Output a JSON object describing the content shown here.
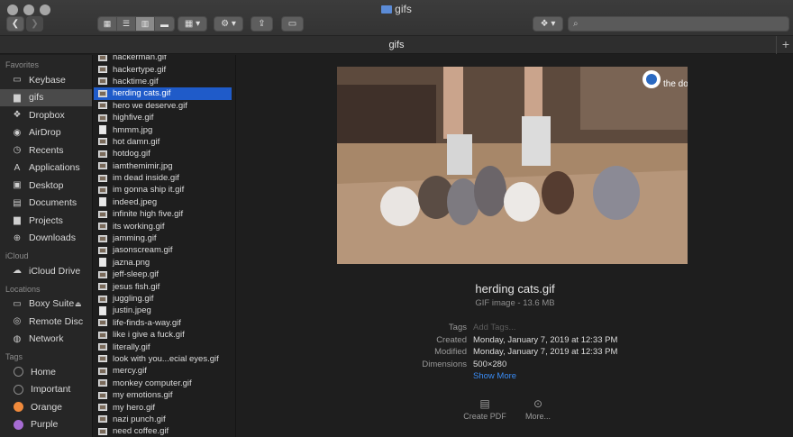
{
  "window": {
    "title": "gifs",
    "path_title": "gifs"
  },
  "toolbar": {
    "search_placeholder": ""
  },
  "sidebar": {
    "sections": [
      {
        "heading": "Favorites",
        "items": [
          {
            "label": "Keybase",
            "icon": "drive-icon"
          },
          {
            "label": "gifs",
            "icon": "folder-icon",
            "selected": true
          },
          {
            "label": "Dropbox",
            "icon": "dropbox-icon"
          },
          {
            "label": "AirDrop",
            "icon": "airdrop-icon"
          },
          {
            "label": "Recents",
            "icon": "clock-icon"
          },
          {
            "label": "Applications",
            "icon": "applications-icon"
          },
          {
            "label": "Desktop",
            "icon": "desktop-icon"
          },
          {
            "label": "Documents",
            "icon": "document-icon"
          },
          {
            "label": "Projects",
            "icon": "folder-icon"
          },
          {
            "label": "Downloads",
            "icon": "downloads-icon"
          }
        ]
      },
      {
        "heading": "iCloud",
        "items": [
          {
            "label": "iCloud Drive",
            "icon": "cloud-icon"
          }
        ]
      },
      {
        "heading": "Locations",
        "items": [
          {
            "label": "Boxy Suite",
            "icon": "drive-icon",
            "eject": "⏏"
          },
          {
            "label": "Remote Disc",
            "icon": "disc-icon"
          },
          {
            "label": "Network",
            "icon": "globe-icon"
          }
        ]
      },
      {
        "heading": "Tags",
        "items": [
          {
            "label": "Home",
            "tag_color": "none"
          },
          {
            "label": "Important",
            "tag_color": "none"
          },
          {
            "label": "Orange",
            "tag_color": "#f08a3c"
          },
          {
            "label": "Purple",
            "tag_color": "#a66cd3"
          }
        ]
      }
    ]
  },
  "files": [
    {
      "name": "hackerman.gif",
      "type": "image"
    },
    {
      "name": "hackertype.gif",
      "type": "image"
    },
    {
      "name": "hacktime.gif",
      "type": "image"
    },
    {
      "name": "herding cats.gif",
      "type": "image",
      "selected": true
    },
    {
      "name": "hero we deserve.gif",
      "type": "image"
    },
    {
      "name": "highfive.gif",
      "type": "image"
    },
    {
      "name": "hmmm.jpg",
      "type": "doc"
    },
    {
      "name": "hot damn.gif",
      "type": "image"
    },
    {
      "name": "hotdog.gif",
      "type": "image"
    },
    {
      "name": "iamthemimir.jpg",
      "type": "image"
    },
    {
      "name": "im dead inside.gif",
      "type": "image"
    },
    {
      "name": "im gonna ship it.gif",
      "type": "image"
    },
    {
      "name": "indeed.jpeg",
      "type": "doc"
    },
    {
      "name": "infinite high five.gif",
      "type": "image"
    },
    {
      "name": "its working.gif",
      "type": "image"
    },
    {
      "name": "jamming.gif",
      "type": "image"
    },
    {
      "name": "jasonscream.gif",
      "type": "image"
    },
    {
      "name": "jazna.png",
      "type": "doc"
    },
    {
      "name": "jeff-sleep.gif",
      "type": "image"
    },
    {
      "name": "jesus fish.gif",
      "type": "image"
    },
    {
      "name": "juggling.gif",
      "type": "image"
    },
    {
      "name": "justin.jpeg",
      "type": "doc"
    },
    {
      "name": "life-finds-a-way.gif",
      "type": "image"
    },
    {
      "name": "like i give a fuck.gif",
      "type": "image"
    },
    {
      "name": "literally.gif",
      "type": "image"
    },
    {
      "name": "look with you...ecial eyes.gif",
      "type": "image"
    },
    {
      "name": "mercy.gif",
      "type": "image"
    },
    {
      "name": "monkey computer.gif",
      "type": "image"
    },
    {
      "name": "my emotions.gif",
      "type": "image"
    },
    {
      "name": "my hero.gif",
      "type": "image"
    },
    {
      "name": "nazi punch.gif",
      "type": "image"
    },
    {
      "name": "need coffee.gif",
      "type": "image"
    }
  ],
  "preview": {
    "thumbnail_watermark": "the dodo",
    "filename": "herding cats.gif",
    "subtitle": "GIF image - 13.6 MB",
    "meta": [
      {
        "key": "Tags",
        "value": "Add Tags...",
        "placeholder": true
      },
      {
        "key": "Created",
        "value": "Monday, January 7, 2019 at 12:33 PM"
      },
      {
        "key": "Modified",
        "value": "Monday, January 7, 2019 at 12:33 PM"
      },
      {
        "key": "Dimensions",
        "value": "500×280"
      }
    ],
    "show_more": "Show More",
    "actions": [
      {
        "label": "Create PDF",
        "icon": "pdf-icon"
      },
      {
        "label": "More...",
        "icon": "more-icon"
      }
    ]
  },
  "colors": {
    "selection": "#1f5bc9",
    "link": "#3a8cf5"
  }
}
